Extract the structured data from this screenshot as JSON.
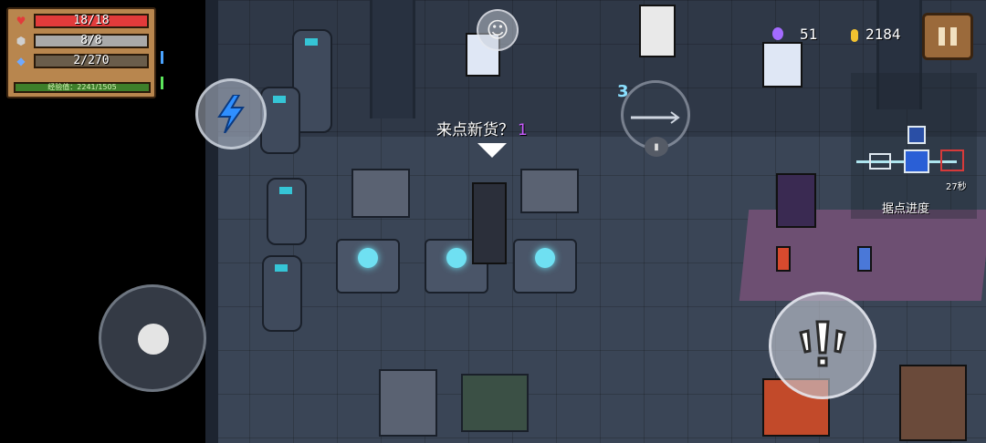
{
  "hud": {
    "health": {
      "current": 18,
      "max": 18,
      "text": "18/18",
      "color": "#e23b3b"
    },
    "armor": {
      "current": 8,
      "max": 8,
      "text": "8/8",
      "color": "#a9a9a9"
    },
    "energy": {
      "current": 2,
      "max": 270,
      "text": "2/270",
      "color": "#6a5d4b"
    },
    "xp": {
      "text": "经验值：2241/1505"
    },
    "gems": "51",
    "coins": "2184"
  },
  "shop": {
    "prompt": "来点新货？",
    "count": "1"
  },
  "weapon": {
    "slot_number": "3"
  },
  "minimap": {
    "timer": "27秒",
    "label": "据点进度"
  },
  "icons": {
    "health": "heart-icon",
    "armor": "shield-icon",
    "energy": "diamond-icon",
    "skill": "lightning-icon",
    "attack": "exclamation-icon",
    "emote": "smiley-icon",
    "pause": "pause-icon"
  },
  "colors": {
    "panel": "#b8864e",
    "accent_cyan": "#6fe0f2",
    "gem_purple": "#a46bff",
    "coin_gold": "#f2c230"
  }
}
